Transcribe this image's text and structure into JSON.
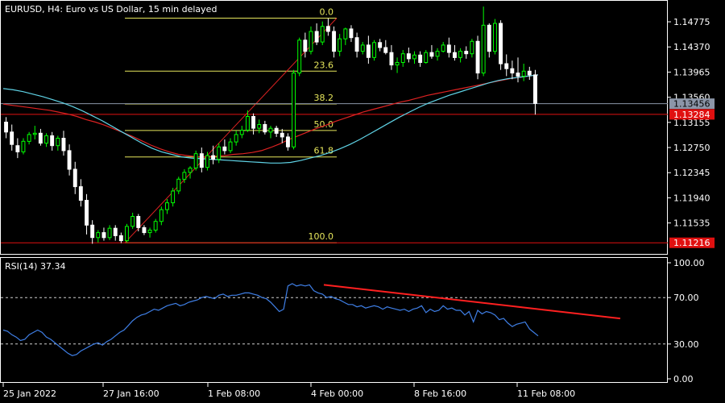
{
  "header": {
    "symbol_line": "EURUSD, H4:  Euro vs US Dollar, 15 min delayed"
  },
  "rsi_label": "RSI(14) 37.34",
  "colors": {
    "background": "#000000",
    "frame": "#ffffff",
    "bull_candle": "#00ff00",
    "bear_candle": "#ffffff",
    "fib": "#e6e65c",
    "ma_red": "#dd2222",
    "ma_cyan": "#5fd3e6",
    "rsi_line": "#3f7fe6",
    "trendline": "#ff2020",
    "badge_gray": "#8c96a8",
    "badge_red": "#e01010",
    "hline_red": "#e01010"
  },
  "chart_data": [
    {
      "type": "candlestick",
      "title": "EURUSD, H4",
      "price_axis_ticks": [
        "1.14775",
        "1.14370",
        "1.13965",
        "1.13560",
        "1.13155",
        "1.12750",
        "1.12345",
        "1.11940",
        "1.11535"
      ],
      "ylim": [
        1.1105,
        1.151
      ],
      "x_ticks": [
        "25 Jan 2022",
        "27 Jan 16:00",
        "1 Feb 08:00",
        "4 Feb 00:00",
        "8 Feb 16:00",
        "11 Feb 08:00"
      ],
      "badges": [
        {
          "value": "1.13456",
          "price": 1.13456,
          "style": "gray"
        },
        {
          "value": "1.13284",
          "price": 1.13284,
          "style": "red"
        },
        {
          "value": "1.11216",
          "price": 1.11216,
          "style": "red"
        }
      ],
      "horizontal_lines": [
        {
          "price": 1.13284,
          "color": "red"
        },
        {
          "price": 1.11216,
          "color": "red"
        }
      ],
      "fibonacci": {
        "high": 1.14834,
        "low": 1.11216,
        "levels": [
          {
            "label": "0.0",
            "price": 1.14834
          },
          {
            "label": "23.6",
            "price": 1.1398
          },
          {
            "label": "38.2",
            "price": 1.13452
          },
          {
            "label": "50.0",
            "price": 1.13025
          },
          {
            "label": "61.8",
            "price": 1.12598
          },
          {
            "label": "100.0",
            "price": 1.11216
          }
        ]
      },
      "candles": [
        [
          1.1316,
          1.1324,
          1.129,
          1.13
        ],
        [
          1.13,
          1.1312,
          1.127,
          1.128
        ],
        [
          1.1278,
          1.129,
          1.1258,
          1.1268
        ],
        [
          1.1268,
          1.129,
          1.1264,
          1.1285
        ],
        [
          1.1285,
          1.13,
          1.128,
          1.1296
        ],
        [
          1.1296,
          1.131,
          1.1288,
          1.1298
        ],
        [
          1.1298,
          1.1305,
          1.1278,
          1.1282
        ],
        [
          1.1282,
          1.1298,
          1.1276,
          1.1294
        ],
        [
          1.1294,
          1.13,
          1.127,
          1.1278
        ],
        [
          1.1278,
          1.1294,
          1.127,
          1.129
        ],
        [
          1.129,
          1.1302,
          1.1262,
          1.127
        ],
        [
          1.127,
          1.128,
          1.123,
          1.124
        ],
        [
          1.124,
          1.1252,
          1.12,
          1.1212
        ],
        [
          1.1212,
          1.1224,
          1.118,
          1.119
        ],
        [
          1.119,
          1.12,
          1.1135,
          1.115
        ],
        [
          1.115,
          1.1158,
          1.112,
          1.113
        ],
        [
          1.113,
          1.1142,
          1.1122,
          1.1138
        ],
        [
          1.1138,
          1.1146,
          1.1125,
          1.113
        ],
        [
          1.113,
          1.115,
          1.1126,
          1.1145
        ],
        [
          1.1145,
          1.115,
          1.1125,
          1.1133
        ],
        [
          1.1133,
          1.1138,
          1.1121,
          1.1125
        ],
        [
          1.1125,
          1.1152,
          1.1122,
          1.1148
        ],
        [
          1.1148,
          1.117,
          1.1144,
          1.1164
        ],
        [
          1.1164,
          1.1168,
          1.114,
          1.1146
        ],
        [
          1.1146,
          1.115,
          1.1134,
          1.1138
        ],
        [
          1.1138,
          1.1146,
          1.113,
          1.1142
        ],
        [
          1.1142,
          1.116,
          1.1138,
          1.1156
        ],
        [
          1.1156,
          1.118,
          1.115,
          1.1175
        ],
        [
          1.1175,
          1.1192,
          1.1168,
          1.1186
        ],
        [
          1.1186,
          1.121,
          1.118,
          1.1205
        ],
        [
          1.1205,
          1.1228,
          1.12,
          1.1224
        ],
        [
          1.1224,
          1.124,
          1.1218,
          1.1235
        ],
        [
          1.1235,
          1.1245,
          1.1225,
          1.1242
        ],
        [
          1.1242,
          1.127,
          1.1238,
          1.1265
        ],
        [
          1.1265,
          1.1275,
          1.1235,
          1.1243
        ],
        [
          1.1243,
          1.1268,
          1.1238,
          1.1262
        ],
        [
          1.1262,
          1.1278,
          1.1248,
          1.1256
        ],
        [
          1.1256,
          1.1282,
          1.125,
          1.1276
        ],
        [
          1.1276,
          1.1288,
          1.1264,
          1.127
        ],
        [
          1.127,
          1.129,
          1.1266,
          1.1284
        ],
        [
          1.1284,
          1.1302,
          1.1278,
          1.1296
        ],
        [
          1.1296,
          1.131,
          1.129,
          1.1303
        ],
        [
          1.1303,
          1.1335,
          1.13,
          1.1325
        ],
        [
          1.1325,
          1.133,
          1.1296,
          1.1306
        ],
        [
          1.1306,
          1.132,
          1.1298,
          1.1312
        ],
        [
          1.1312,
          1.1318,
          1.1296,
          1.13
        ],
        [
          1.13,
          1.131,
          1.129,
          1.1306
        ],
        [
          1.1306,
          1.131,
          1.1292,
          1.1298
        ],
        [
          1.1298,
          1.1305,
          1.1282,
          1.1292
        ],
        [
          1.1292,
          1.1298,
          1.127,
          1.1276
        ],
        [
          1.1276,
          1.14,
          1.1272,
          1.1395
        ],
        [
          1.1395,
          1.1452,
          1.139,
          1.1448
        ],
        [
          1.1448,
          1.146,
          1.142,
          1.143
        ],
        [
          1.143,
          1.147,
          1.1425,
          1.1462
        ],
        [
          1.1462,
          1.1475,
          1.144,
          1.1445
        ],
        [
          1.1445,
          1.1478,
          1.144,
          1.147
        ],
        [
          1.147,
          1.1483,
          1.1455,
          1.1462
        ],
        [
          1.1462,
          1.147,
          1.142,
          1.143
        ],
        [
          1.143,
          1.1458,
          1.1422,
          1.145
        ],
        [
          1.145,
          1.1468,
          1.144,
          1.1466
        ],
        [
          1.1466,
          1.1472,
          1.1445,
          1.1452
        ],
        [
          1.1452,
          1.146,
          1.142,
          1.143
        ],
        [
          1.143,
          1.1445,
          1.1425,
          1.144
        ],
        [
          1.144,
          1.1455,
          1.141,
          1.142
        ],
        [
          1.142,
          1.1448,
          1.1415,
          1.1444
        ],
        [
          1.1444,
          1.145,
          1.143,
          1.1436
        ],
        [
          1.1436,
          1.1448,
          1.1425,
          1.1428
        ],
        [
          1.1428,
          1.144,
          1.14,
          1.1408
        ],
        [
          1.1408,
          1.142,
          1.1395,
          1.1412
        ],
        [
          1.1412,
          1.1432,
          1.1405,
          1.1426
        ],
        [
          1.1426,
          1.1436,
          1.1412,
          1.1418
        ],
        [
          1.1418,
          1.143,
          1.141,
          1.1424
        ],
        [
          1.1424,
          1.143,
          1.1405,
          1.1412
        ],
        [
          1.1412,
          1.1432,
          1.141,
          1.1428
        ],
        [
          1.1428,
          1.144,
          1.1418,
          1.1422
        ],
        [
          1.1422,
          1.1435,
          1.1415,
          1.143
        ],
        [
          1.143,
          1.1445,
          1.1428,
          1.144
        ],
        [
          1.144,
          1.1452,
          1.142,
          1.1428
        ],
        [
          1.1428,
          1.144,
          1.1415,
          1.142
        ],
        [
          1.142,
          1.1435,
          1.1412,
          1.143
        ],
        [
          1.143,
          1.1438,
          1.1418,
          1.1426
        ],
        [
          1.1426,
          1.145,
          1.142,
          1.1446
        ],
        [
          1.1446,
          1.1455,
          1.1385,
          1.1395
        ],
        [
          1.1395,
          1.1502,
          1.139,
          1.1472
        ],
        [
          1.1472,
          1.1475,
          1.142,
          1.143
        ],
        [
          1.143,
          1.1482,
          1.1425,
          1.1475
        ],
        [
          1.1475,
          1.148,
          1.14,
          1.141
        ],
        [
          1.141,
          1.1425,
          1.139,
          1.1402
        ],
        [
          1.1402,
          1.1415,
          1.1385,
          1.1395
        ],
        [
          1.1395,
          1.142,
          1.138,
          1.139
        ],
        [
          1.139,
          1.141,
          1.1382,
          1.1398
        ],
        [
          1.1398,
          1.1405,
          1.1384,
          1.1392
        ],
        [
          1.1392,
          1.14,
          1.1328,
          1.1346
        ]
      ],
      "ma_red": [
        1.1345,
        1.1343,
        1.1341,
        1.1339,
        1.1337,
        1.1335,
        1.1332,
        1.1329,
        1.1325,
        1.132,
        1.1316,
        1.1311,
        1.1305,
        1.1299,
        1.1293,
        1.1286,
        1.1279,
        1.1273,
        1.1268,
        1.1264,
        1.1262,
        1.126,
        1.126,
        1.1261,
        1.1262,
        1.1264,
        1.1265,
        1.1267,
        1.127,
        1.1275,
        1.1281,
        1.1288,
        1.1294,
        1.13,
        1.1306,
        1.1311,
        1.1317,
        1.1322,
        1.1327,
        1.1332,
        1.1336,
        1.134,
        1.1344,
        1.1348,
        1.1351,
        1.1355,
        1.1359,
        1.1362,
        1.1365,
        1.1368,
        1.1371,
        1.1374,
        1.1377,
        1.138,
        1.1383,
        1.1386,
        1.1388,
        1.139,
        1.1392
      ],
      "ma_cyan": [
        1.137,
        1.1368,
        1.1365,
        1.1361,
        1.1357,
        1.1352,
        1.1347,
        1.1341,
        1.1334,
        1.1326,
        1.1318,
        1.1309,
        1.13,
        1.1291,
        1.1282,
        1.1274,
        1.1268,
        1.1264,
        1.126,
        1.1258,
        1.1257,
        1.1256,
        1.1255,
        1.1254,
        1.1253,
        1.1252,
        1.1251,
        1.125,
        1.125,
        1.1251,
        1.1254,
        1.1258,
        1.1262,
        1.1267,
        1.1273,
        1.128,
        1.1288,
        1.1297,
        1.1306,
        1.1315,
        1.1324,
        1.1332,
        1.134,
        1.1347,
        1.1353,
        1.1359,
        1.1364,
        1.1369,
        1.1374,
        1.1379,
        1.1383,
        1.1386,
        1.1388,
        1.139,
        1.1392
      ],
      "fib_trend": {
        "from_price": 1.11216,
        "to_price": 1.14834
      }
    },
    {
      "type": "line",
      "title": "RSI(14) 37.34",
      "ylim": [
        0,
        100
      ],
      "y_ticks": [
        "100.00",
        "70.00",
        "30.00",
        "0.00"
      ],
      "levels": [
        70,
        30
      ],
      "series": [
        {
          "values": [
            42,
            41,
            38,
            36,
            33,
            34,
            38,
            40,
            42,
            40,
            36,
            34,
            31,
            28,
            25,
            22,
            20,
            21,
            24,
            26,
            28,
            30,
            31,
            29,
            32,
            34,
            37,
            40,
            42,
            46,
            50,
            53,
            55,
            56,
            58,
            60,
            59,
            61,
            63,
            64,
            65,
            63,
            64,
            66,
            67,
            68,
            70,
            71,
            70,
            69,
            72,
            73,
            71,
            72,
            72,
            73,
            74,
            74,
            73,
            72,
            70,
            69,
            66,
            62,
            58,
            60,
            80,
            82,
            80,
            81,
            80,
            81,
            76,
            74,
            73,
            70,
            71,
            69,
            68,
            66,
            64,
            64,
            62,
            63,
            61,
            62,
            63,
            62,
            60,
            62,
            61,
            60,
            59,
            60,
            58,
            60,
            61,
            63,
            57,
            60,
            58,
            59,
            63,
            60,
            61,
            59,
            59,
            55,
            58,
            49,
            59,
            56,
            58,
            57,
            55,
            51,
            52,
            48,
            45,
            47,
            48,
            49,
            43,
            40,
            37
          ]
        }
      ],
      "trendline": {
        "from_value": 81,
        "to_value": 52
      }
    }
  ]
}
